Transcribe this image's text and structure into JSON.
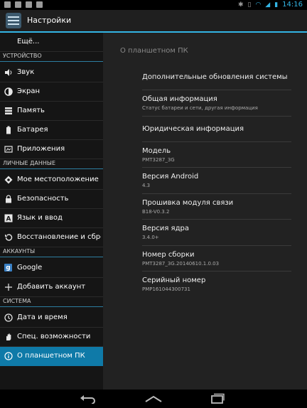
{
  "status_bar": {
    "time": "14:16",
    "left_icons": [
      "notification-icon",
      "notification-icon",
      "notification-icon",
      "notification-icon"
    ],
    "right_icons": [
      "bluetooth-icon",
      "vibrate-icon",
      "wifi-icon",
      "signal-icon",
      "battery-icon"
    ],
    "accent": "#33b5e5"
  },
  "action_bar": {
    "title": "Настройки"
  },
  "sidebar": {
    "more_label": "Ещё...",
    "headers": [
      "УСТРОЙСТВО",
      "ЛИЧНЫЕ ДАННЫЕ",
      "АККАУНТЫ",
      "СИСТЕМА"
    ],
    "items": [
      {
        "label": "Звук",
        "icon": "volume-icon"
      },
      {
        "label": "Экран",
        "icon": "brightness-icon"
      },
      {
        "label": "Память",
        "icon": "storage-icon"
      },
      {
        "label": "Батарея",
        "icon": "battery-icon"
      },
      {
        "label": "Приложения",
        "icon": "apps-icon"
      },
      {
        "label": "Мое местоположение",
        "icon": "location-icon"
      },
      {
        "label": "Безопасность",
        "icon": "lock-icon"
      },
      {
        "label": "Язык и ввод",
        "icon": "language-icon"
      },
      {
        "label": "Восстановление и сброс",
        "icon": "restore-icon"
      },
      {
        "label": "Google",
        "icon": "google-icon",
        "icon_text": "g"
      },
      {
        "label": "Добавить аккаунт",
        "icon": "plus-icon"
      },
      {
        "label": "Дата и время",
        "icon": "clock-icon"
      },
      {
        "label": "Спец. возможности",
        "icon": "hand-icon"
      },
      {
        "label": "О планшетном ПК",
        "icon": "info-icon",
        "selected": true
      }
    ]
  },
  "content": {
    "title": "О планшетном ПК",
    "rows": [
      {
        "title": "Дополнительные обновления системы",
        "sub": ""
      },
      {
        "title": "Общая информация",
        "sub": "Статус батареи и сети, другая информация"
      },
      {
        "title": "Юридическая информация",
        "sub": ""
      },
      {
        "title": "Модель",
        "sub": "PMT3287_3G"
      },
      {
        "title": "Версия Android",
        "sub": "4.3"
      },
      {
        "title": "Прошивка модуля связи",
        "sub": "B18-V0.3.2"
      },
      {
        "title": "Версия ядра",
        "sub": "3.4.0+"
      },
      {
        "title": "Номер сборки",
        "sub": "PMT3287_3G.20140610.1.0.03"
      },
      {
        "title": "Серийный номер",
        "sub": "PMP161044300731"
      }
    ]
  },
  "nav_bar": {
    "buttons": [
      "back-icon",
      "home-icon",
      "recents-icon"
    ]
  }
}
